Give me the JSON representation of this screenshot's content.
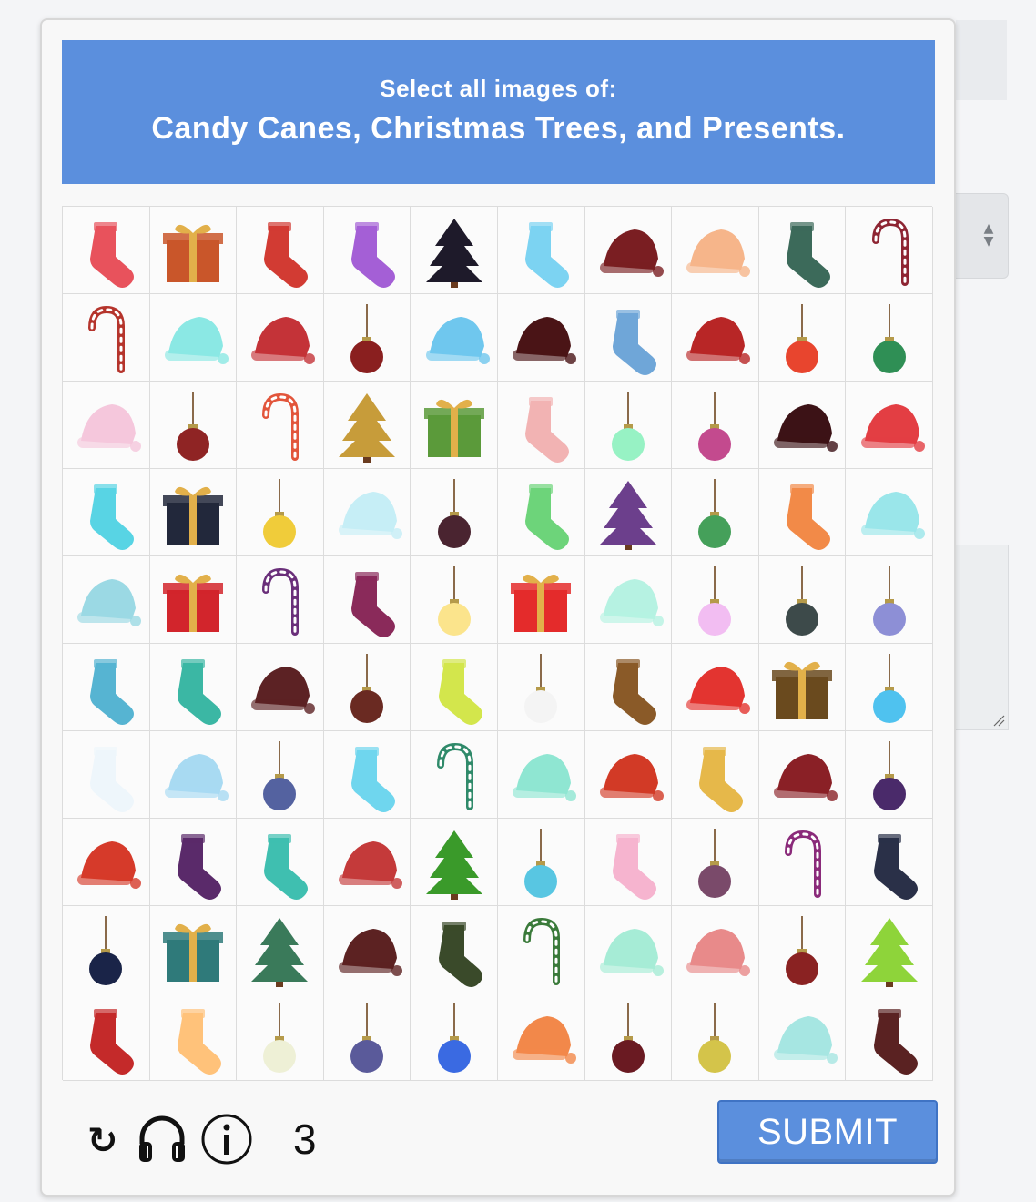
{
  "captcha": {
    "prompt_line1": "Select all images of:",
    "prompt_line2": "Candy Canes, Christmas Trees, and Presents.",
    "submit_label": "SUBMIT",
    "reload_glyph": "↻",
    "remaining_count": "3",
    "colors": {
      "accent": "#5b8fdd",
      "accent_border": "#3f73c4"
    },
    "grid": [
      [
        {
          "k": "stocking",
          "c": "#e8525c"
        },
        {
          "k": "present",
          "c": "#c9562a"
        },
        {
          "k": "stocking",
          "c": "#d23b33"
        },
        {
          "k": "stocking",
          "c": "#a45fd6"
        },
        {
          "k": "tree",
          "c": "#1e1a2a"
        },
        {
          "k": "stocking",
          "c": "#7cd3f2"
        },
        {
          "k": "hat",
          "c": "#7a1e22"
        },
        {
          "k": "hat",
          "c": "#f6b58a"
        },
        {
          "k": "stocking",
          "c": "#3c6a5a"
        },
        {
          "k": "cane",
          "c": "#8e2533"
        }
      ],
      [
        {
          "k": "cane",
          "c": "#b5342c"
        },
        {
          "k": "hat",
          "c": "#8be8e4"
        },
        {
          "k": "hat",
          "c": "#c43338"
        },
        {
          "k": "ornament",
          "c": "#8a1f1f"
        },
        {
          "k": "hat",
          "c": "#6fc7ee"
        },
        {
          "k": "hat",
          "c": "#4a1416"
        },
        {
          "k": "stocking",
          "c": "#6fa6d8"
        },
        {
          "k": "hat",
          "c": "#b82626"
        },
        {
          "k": "ornament",
          "c": "#e8452e"
        },
        {
          "k": "ornament",
          "c": "#2f8f55"
        }
      ],
      [
        {
          "k": "hat",
          "c": "#f5c7dc"
        },
        {
          "k": "ornament",
          "c": "#8f2424"
        },
        {
          "k": "cane",
          "c": "#e2553b"
        },
        {
          "k": "tree",
          "c": "#c79c3a"
        },
        {
          "k": "present",
          "c": "#5b9a3a"
        },
        {
          "k": "stocking",
          "c": "#f2b3b3"
        },
        {
          "k": "ornament",
          "c": "#97f2c4"
        },
        {
          "k": "ornament",
          "c": "#c34a8e"
        },
        {
          "k": "hat",
          "c": "#3c1216"
        },
        {
          "k": "hat",
          "c": "#e33e43"
        }
      ],
      [
        {
          "k": "stocking",
          "c": "#58d4e4"
        },
        {
          "k": "present",
          "c": "#22283b"
        },
        {
          "k": "ornament",
          "c": "#f0cc3a"
        },
        {
          "k": "hat",
          "c": "#c6eef6"
        },
        {
          "k": "ornament",
          "c": "#4a2430"
        },
        {
          "k": "stocking",
          "c": "#6dd47a"
        },
        {
          "k": "tree",
          "c": "#6c3f8c"
        },
        {
          "k": "ornament",
          "c": "#45a05a"
        },
        {
          "k": "stocking",
          "c": "#f28a48"
        },
        {
          "k": "hat",
          "c": "#9ae6ea"
        }
      ],
      [
        {
          "k": "hat",
          "c": "#9bd9e4"
        },
        {
          "k": "present",
          "c": "#d2252c"
        },
        {
          "k": "cane",
          "c": "#6a2f7a"
        },
        {
          "k": "stocking",
          "c": "#8a2a5a"
        },
        {
          "k": "ornament",
          "c": "#fbe48c"
        },
        {
          "k": "present",
          "c": "#e42b2b"
        },
        {
          "k": "hat",
          "c": "#b6f2e2"
        },
        {
          "k": "ornament",
          "c": "#f2bdf2"
        },
        {
          "k": "ornament",
          "c": "#3d4a4a"
        },
        {
          "k": "ornament",
          "c": "#8d8fd6"
        }
      ],
      [
        {
          "k": "stocking",
          "c": "#56b4d2"
        },
        {
          "k": "stocking",
          "c": "#3bb7a4"
        },
        {
          "k": "hat",
          "c": "#5c2224"
        },
        {
          "k": "ornament",
          "c": "#6a2a22"
        },
        {
          "k": "stocking",
          "c": "#d3e64c"
        },
        {
          "k": "ornament",
          "c": "#f4f4f4"
        },
        {
          "k": "stocking",
          "c": "#8a5a28"
        },
        {
          "k": "hat",
          "c": "#e33430"
        },
        {
          "k": "present",
          "c": "#6a4a1e"
        },
        {
          "k": "ornament",
          "c": "#4fc2ef"
        }
      ],
      [
        {
          "k": "stocking",
          "c": "#eef6fb"
        },
        {
          "k": "hat",
          "c": "#a8daf2"
        },
        {
          "k": "ornament",
          "c": "#5462a0"
        },
        {
          "k": "stocking",
          "c": "#6fd6ee"
        },
        {
          "k": "cane",
          "c": "#2f8a6a"
        },
        {
          "k": "hat",
          "c": "#8fe6d2"
        },
        {
          "k": "hat",
          "c": "#d23a26"
        },
        {
          "k": "stocking",
          "c": "#e6b84a"
        },
        {
          "k": "hat",
          "c": "#8a2026"
        },
        {
          "k": "ornament",
          "c": "#4a2a6a"
        }
      ],
      [
        {
          "k": "hat",
          "c": "#d63a2a"
        },
        {
          "k": "stocking",
          "c": "#5a2a6a"
        },
        {
          "k": "stocking",
          "c": "#3fbfb0"
        },
        {
          "k": "hat",
          "c": "#c43a3a"
        },
        {
          "k": "tree",
          "c": "#3a9a2a"
        },
        {
          "k": "ornament",
          "c": "#58c6e2"
        },
        {
          "k": "stocking",
          "c": "#f6b4cf"
        },
        {
          "k": "ornament",
          "c": "#7a4a6a"
        },
        {
          "k": "cane",
          "c": "#8a2a7a"
        },
        {
          "k": "stocking",
          "c": "#2a3048"
        }
      ],
      [
        {
          "k": "ornament",
          "c": "#1a2448"
        },
        {
          "k": "present",
          "c": "#2f7a7a"
        },
        {
          "k": "tree",
          "c": "#3a7a5a"
        },
        {
          "k": "hat",
          "c": "#5c2222"
        },
        {
          "k": "stocking",
          "c": "#3a4a2a"
        },
        {
          "k": "cane",
          "c": "#3a7a3a"
        },
        {
          "k": "hat",
          "c": "#a6ecd6"
        },
        {
          "k": "hat",
          "c": "#e88a8a"
        },
        {
          "k": "ornament",
          "c": "#8a2222"
        },
        {
          "k": "tree",
          "c": "#8ed43a"
        }
      ],
      [
        {
          "k": "stocking",
          "c": "#c42a2a"
        },
        {
          "k": "stocking",
          "c": "#ffc27a"
        },
        {
          "k": "ornament",
          "c": "#eef0d6"
        },
        {
          "k": "ornament",
          "c": "#5a5a9a"
        },
        {
          "k": "ornament",
          "c": "#3a6ae2"
        },
        {
          "k": "hat",
          "c": "#f2884a"
        },
        {
          "k": "ornament",
          "c": "#6a1a22"
        },
        {
          "k": "ornament",
          "c": "#d4c44a"
        },
        {
          "k": "hat",
          "c": "#a6e6e2"
        },
        {
          "k": "stocking",
          "c": "#5a2222"
        }
      ]
    ]
  }
}
